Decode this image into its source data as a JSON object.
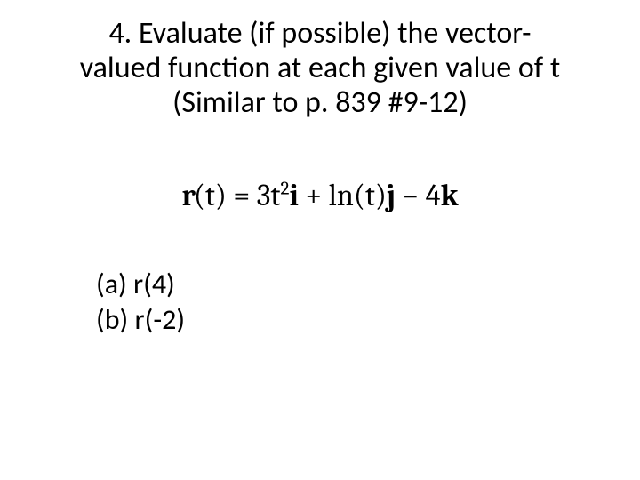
{
  "title": {
    "line1": "4. Evaluate (if possible) the vector-",
    "line2": "valued function at each given value of t",
    "line3": "(Similar to p. 839 #9-12)"
  },
  "formula": {
    "lhs_bold": "r",
    "lhs_paren": "(t) = ",
    "term1_coeff": "3t",
    "term1_exp": "2",
    "unit_i": "i",
    "plus": " + ",
    "ln": "ln",
    "ln_arg": "(t)",
    "unit_j": "j",
    "minus": " − 4",
    "unit_k": "k"
  },
  "parts": {
    "a_label": "(a) ",
    "a_value": "r(4)",
    "b_label": "(b) ",
    "b_value": "r(-2)"
  }
}
